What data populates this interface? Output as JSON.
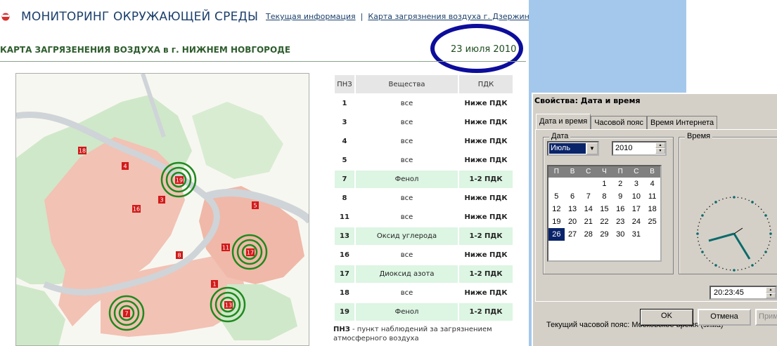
{
  "header": {
    "site_title": "МОНИТОРИНГ ОКРУЖАЮЩЕЙ СРЕДЫ",
    "nav": [
      {
        "label": "Текущая информация"
      },
      {
        "label": "Карта загрязнения воздуха г. Дзержинска"
      }
    ],
    "nav_separator": "|"
  },
  "main": {
    "map_title": "КАРТА ЗАГРЯЗЕНЕНИЯ ВОЗДУХА в г. НИЖНЕМ НОВГОРОДЕ",
    "date": "23 июля 2010",
    "map": {
      "stations": [
        {
          "id": "18",
          "alert": false
        },
        {
          "id": "4",
          "alert": false
        },
        {
          "id": "19",
          "alert": true
        },
        {
          "id": "3",
          "alert": false
        },
        {
          "id": "16",
          "alert": false
        },
        {
          "id": "5",
          "alert": false
        },
        {
          "id": "11",
          "alert": false
        },
        {
          "id": "17",
          "alert": true
        },
        {
          "id": "8",
          "alert": false
        },
        {
          "id": "1",
          "alert": false
        },
        {
          "id": "13",
          "alert": true
        },
        {
          "id": "7",
          "alert": true
        }
      ]
    },
    "table": {
      "headers": [
        "ПНЗ",
        "Вещества",
        "ПДК"
      ],
      "rows": [
        {
          "pnz": "1",
          "substance": "все",
          "pdk": "Ниже ПДК",
          "alert": false
        },
        {
          "pnz": "3",
          "substance": "все",
          "pdk": "Ниже ПДК",
          "alert": false
        },
        {
          "pnz": "4",
          "substance": "все",
          "pdk": "Ниже ПДК",
          "alert": false
        },
        {
          "pnz": "5",
          "substance": "все",
          "pdk": "Ниже ПДК",
          "alert": false
        },
        {
          "pnz": "7",
          "substance": "Фенол",
          "pdk": "1-2 ПДК",
          "alert": true
        },
        {
          "pnz": "8",
          "substance": "все",
          "pdk": "Ниже ПДК",
          "alert": false
        },
        {
          "pnz": "11",
          "substance": "все",
          "pdk": "Ниже ПДК",
          "alert": false
        },
        {
          "pnz": "13",
          "substance": "Оксид углерода",
          "pdk": "1-2 ПДК",
          "alert": true
        },
        {
          "pnz": "16",
          "substance": "все",
          "pdk": "Ниже ПДК",
          "alert": false
        },
        {
          "pnz": "17",
          "substance": "Диоксид азота",
          "pdk": "1-2 ПДК",
          "alert": true
        },
        {
          "pnz": "18",
          "substance": "все",
          "pdk": "Ниже ПДК",
          "alert": false
        },
        {
          "pnz": "19",
          "substance": "Фенол",
          "pdk": "1-2 ПДК",
          "alert": true
        }
      ]
    },
    "footnote_term": "ПНЗ",
    "footnote_text": " - пункт наблюдений за загрязнением атмосферного воздуха"
  },
  "dialog": {
    "title": "Свойства: Дата и время",
    "tabs": [
      "Дата и время",
      "Часовой пояс",
      "Время Интернета"
    ],
    "date_group_label": "Дата",
    "time_group_label": "Время",
    "month": "Июль",
    "year": "2010",
    "weekday_headers": [
      "П",
      "В",
      "С",
      "Ч",
      "П",
      "С",
      "В"
    ],
    "calendar_days": [
      "",
      "",
      "",
      "1",
      "2",
      "3",
      "4",
      "5",
      "6",
      "7",
      "8",
      "9",
      "10",
      "11",
      "12",
      "13",
      "14",
      "15",
      "16",
      "17",
      "18",
      "19",
      "20",
      "21",
      "22",
      "23",
      "24",
      "25",
      "26",
      "27",
      "28",
      "29",
      "30",
      "31",
      "",
      "",
      "",
      ""
    ],
    "selected_day": "26",
    "time": "20:23:45",
    "timezone_text": "Текущий часовой пояс: Московское время (зима)",
    "ok_label": "OK",
    "cancel_label": "Отмена",
    "apply_label": "Примен"
  },
  "colors": {
    "brand_blue": "#1b3f6b",
    "title_green": "#2e5d2e",
    "highlight_circle": "#0d0d9c",
    "alert_row": "#ddf5e3",
    "station_red": "#d11a1a",
    "alert_ring": "#1e8a1e",
    "desktop_blue": "#a4c8ec",
    "dialog_gray": "#d4d0c8"
  }
}
